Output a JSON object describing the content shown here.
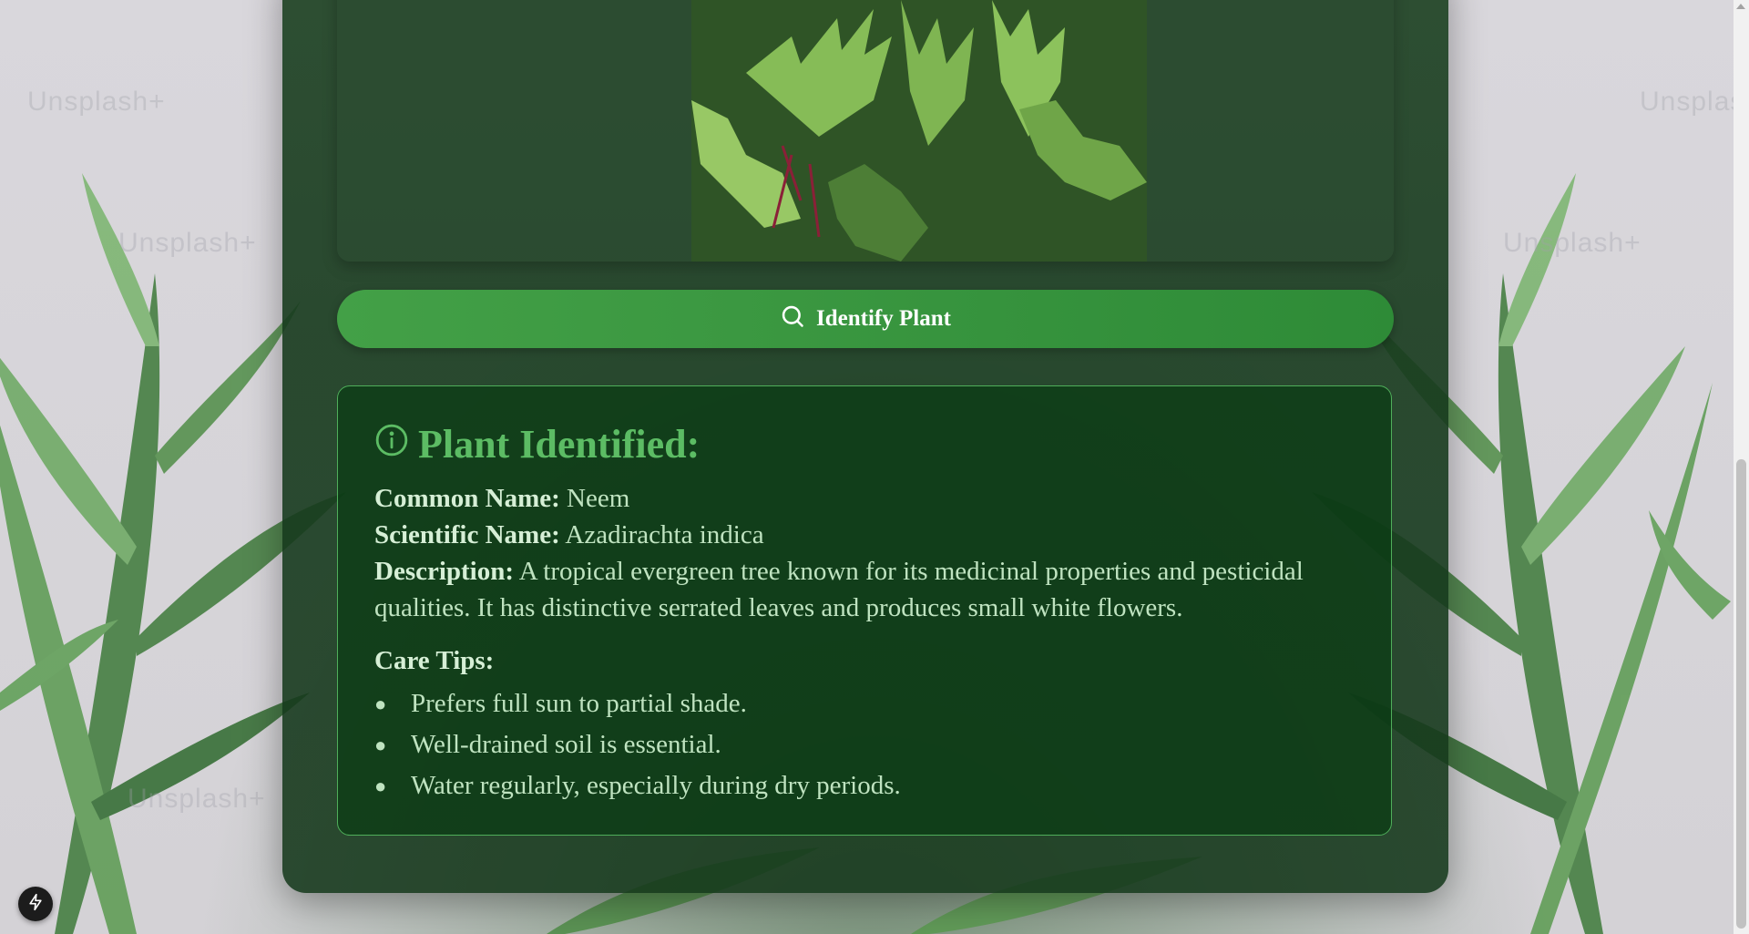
{
  "colors": {
    "accent": "#43a047",
    "title_green": "#5cbc64",
    "panel_bg": "#183c1e",
    "text": "#bfe3c0"
  },
  "background": {
    "watermark_text": "Unsplash+"
  },
  "image": {
    "icon": "plant-image"
  },
  "identify_button": {
    "icon": "search-icon",
    "label": "Identify Plant"
  },
  "result": {
    "icon": "info-icon",
    "title": "Plant Identified:",
    "common_name_label": "Common Name:",
    "common_name": "Neem",
    "scientific_name_label": "Scientific Name:",
    "scientific_name": "Azadirachta indica",
    "description_label": "Description:",
    "description": "A tropical evergreen tree known for its medicinal properties and pesticidal qualities. It has distinctive serrated leaves and produces small white flowers.",
    "care_tips_label": "Care Tips:",
    "care_tips": [
      "Prefers full sun to partial shade.",
      "Well-drained soil is essential.",
      "Water regularly, especially during dry periods."
    ]
  },
  "floating_button": {
    "icon": "bolt-icon"
  }
}
